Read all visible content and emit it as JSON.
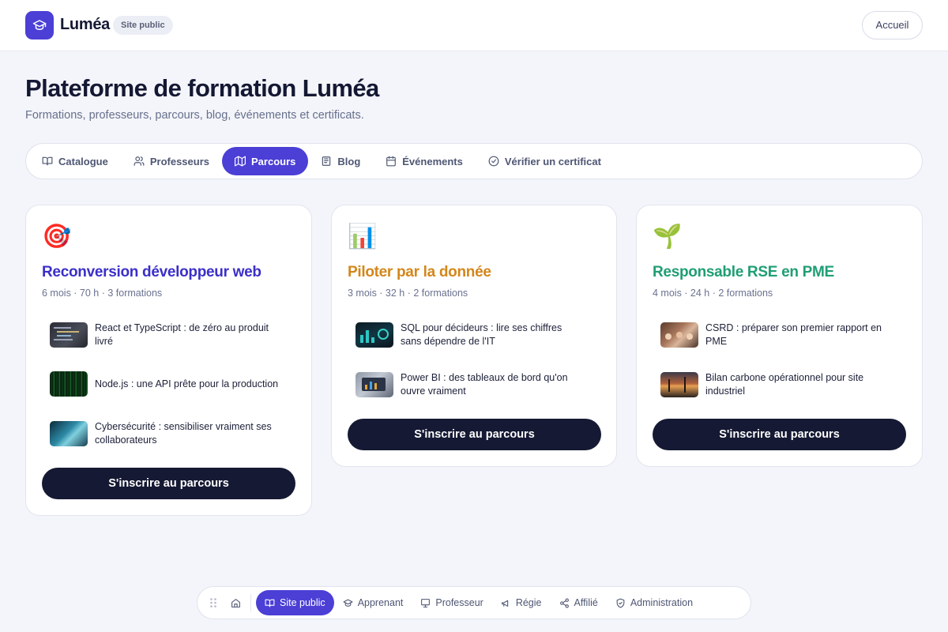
{
  "header": {
    "brand": "Luméa",
    "badge": "Site public",
    "home_button": "Accueil"
  },
  "page": {
    "title": "Plateforme de formation Luméa",
    "subtitle": "Formations, professeurs, parcours, blog, événements et certificats."
  },
  "tabs": [
    {
      "label": "Catalogue",
      "icon": "book-open-icon",
      "active": false
    },
    {
      "label": "Professeurs",
      "icon": "users-icon",
      "active": false
    },
    {
      "label": "Parcours",
      "icon": "map-icon",
      "active": true
    },
    {
      "label": "Blog",
      "icon": "newspaper-icon",
      "active": false
    },
    {
      "label": "Événements",
      "icon": "calendar-icon",
      "active": false
    },
    {
      "label": "Vérifier un certificat",
      "icon": "check-circle-icon",
      "active": false
    }
  ],
  "cards": [
    {
      "emoji": "🎯",
      "title": "Reconversion développeur web",
      "color": "#3b2fc9",
      "meta": "6 mois · 70 h · 3 formations",
      "courses": [
        {
          "title": "React et TypeScript : de zéro au produit livré",
          "thumb": "code-screen"
        },
        {
          "title": "Node.js : une API prête pour la production",
          "thumb": "matrix-code"
        },
        {
          "title": "Cybersécurité : sensibiliser vraiment ses collaborateurs",
          "thumb": "cyber-laptop"
        }
      ],
      "cta": "S'inscrire au parcours"
    },
    {
      "emoji": "📊",
      "title": "Piloter par la donnée",
      "color": "#d4861a",
      "meta": "3 mois · 32 h · 2 formations",
      "courses": [
        {
          "title": "SQL pour décideurs : lire ses chiffres sans dépendre de l'IT",
          "thumb": "dashboard-dark"
        },
        {
          "title": "Power BI : des tableaux de bord qu'on ouvre vraiment",
          "thumb": "laptop-chart"
        }
      ],
      "cta": "S'inscrire au parcours"
    },
    {
      "emoji": "🌱",
      "title": "Responsable RSE en PME",
      "color": "#1f9e74",
      "meta": "4 mois · 24 h · 2 formations",
      "courses": [
        {
          "title": "CSRD : préparer son premier rapport en PME",
          "thumb": "meeting"
        },
        {
          "title": "Bilan carbone opérationnel pour site industriel",
          "thumb": "industrial-sunset"
        }
      ],
      "cta": "S'inscrire au parcours"
    }
  ],
  "dock": [
    {
      "label": "Site public",
      "icon": "book-open-icon",
      "active": true
    },
    {
      "label": "Apprenant",
      "icon": "graduation-cap-icon",
      "active": false
    },
    {
      "label": "Professeur",
      "icon": "presentation-icon",
      "active": false
    },
    {
      "label": "Régie",
      "icon": "megaphone-icon",
      "active": false
    },
    {
      "label": "Affilié",
      "icon": "share-icon",
      "active": false
    },
    {
      "label": "Administration",
      "icon": "shield-icon",
      "active": false
    }
  ],
  "colors": {
    "accent": "#4b3fd6",
    "cta": "#151933",
    "background": "#f4f5fa"
  }
}
